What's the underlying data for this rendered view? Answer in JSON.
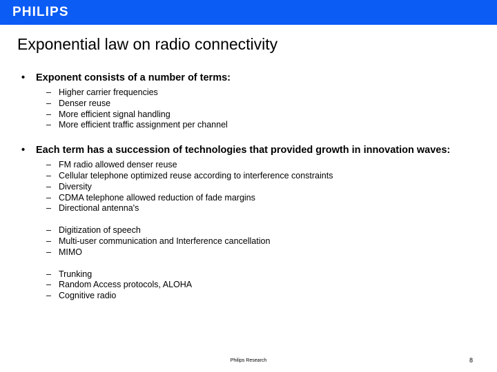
{
  "banner": {
    "brand": "PHILIPS",
    "background_color": "#0b5cf5",
    "text_color": "#ffffff"
  },
  "slide": {
    "title": "Exponential law on radio connectivity",
    "page_number": "8",
    "footer_note": "Philips Research"
  },
  "sections": [
    {
      "heading": "Exponent consists of a number of terms:",
      "groups": [
        {
          "items": [
            "Higher carrier frequencies",
            "Denser reuse",
            "More efficient signal handling",
            "More efficient traffic assignment per channel"
          ]
        }
      ]
    },
    {
      "heading": "Each term has a succession of technologies that provided growth in innovation waves:",
      "groups": [
        {
          "items": [
            "FM radio allowed denser reuse",
            "Cellular telephone optimized reuse according to interference constraints",
            "Diversity",
            "CDMA telephone allowed reduction of fade margins",
            "Directional antenna's"
          ]
        },
        {
          "items": [
            "Digitization of speech",
            "Multi-user communication and Interference cancellation",
            "MIMO"
          ]
        },
        {
          "items": [
            "Trunking",
            "Random Access protocols, ALOHA",
            "Cognitive radio"
          ]
        }
      ]
    }
  ],
  "glyphs": {
    "bullet_dot": "•",
    "bullet_dash": "–"
  }
}
